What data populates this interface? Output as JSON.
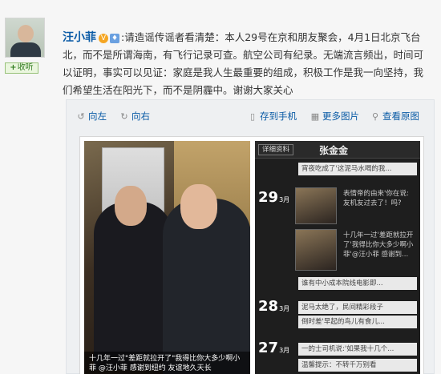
{
  "post": {
    "author": "汪小菲",
    "verified_glyph": "V",
    "vip_glyph": "♦",
    "colon": ":",
    "text": "请造谣传谣者看清楚：本人29号在京和朋友聚会，4月1日北京飞台北，而不是所谓海南，有飞行记录可查。航空公司有纪录。无端流言频出，时间可以证明，事实可以见证：家庭是我人生最重要的组成，积极工作是我一向坚持，我们希望生活在阳光下，而不是阴霾中。谢谢大家关心",
    "follow_label": "收听",
    "follow_plus": "+"
  },
  "toolbar": {
    "rotate_left": "向左",
    "rotate_right": "向右",
    "save_to_phone": "存到手机",
    "more_images": "更多图片",
    "view_original": "查看原图"
  },
  "image": {
    "caption": "十几年一过\"差距就拉开了\"我得比你大多少啊小菲 @汪小菲 感谢到纽约 友谊地久天长",
    "phone": {
      "detail_tag": "详细资料",
      "profile_name": "张金金",
      "items": [
        {
          "text": "宵夜吃成了'这泥马水喝的我..."
        },
        {
          "date": "29",
          "month": "3月",
          "text": "表情帝的由来'你在说:友机友过去了！吗?"
        },
        {
          "text": "十几年一过'差距就拉开了'我得比你大多少啊小菲'@汪小菲 感谢到..."
        },
        {
          "text": "谁有中小成本院线电影即..."
        },
        {
          "date": "28",
          "month": "3月",
          "text": "泥马太绝了，民间精彩段子"
        },
        {
          "text": "倒时差'早起的鸟儿有食儿..."
        },
        {
          "date": "27",
          "month": "3月",
          "text": "一的士司机说:'如果我十几个..."
        },
        {
          "text": "温馨提示：不转千万别看"
        }
      ]
    }
  },
  "colors": {
    "link_blue": "#0a5ba6",
    "follow_green": "#2f7a1f",
    "background": "#f6f6f6"
  }
}
